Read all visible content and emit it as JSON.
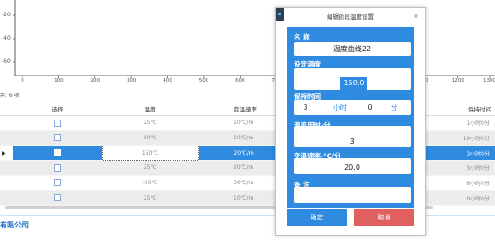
{
  "colors": {
    "accent": "#2e8be0",
    "cancel": "#e05f5f",
    "row_alt": "#ececec"
  },
  "chart": {
    "y_labels": [
      "-20",
      "-40",
      "-60"
    ],
    "x_labels": [
      "0",
      "100",
      "200",
      "300",
      "400",
      "500",
      "600",
      "700",
      "800",
      "900",
      "1000",
      "1100",
      "1200",
      "1300"
    ]
  },
  "table": {
    "summary": "共: 6 项",
    "columns": {
      "select": "选择",
      "temperature": "温度",
      "rate": "变温速率",
      "hold": "保持时间"
    },
    "rows": [
      {
        "temperature": "25℃",
        "rate": "10℃/m",
        "hold": "1小时0分",
        "selected": false
      },
      {
        "temperature": "80℃",
        "rate": "10℃/m",
        "hold": "10小时0分",
        "selected": false
      },
      {
        "temperature": "150℃",
        "rate": "20℃/m",
        "hold": "3小时0分",
        "selected": true
      },
      {
        "temperature": "25℃",
        "rate": "20℃/m",
        "hold": "3小时0分",
        "selected": false
      },
      {
        "temperature": "-50℃",
        "rate": "30℃/m",
        "hold": "6小时0分",
        "selected": false
      },
      {
        "temperature": "25℃",
        "rate": "10℃/m",
        "hold": "0小时0分",
        "selected": false
      }
    ]
  },
  "footer": {
    "company": "有限公司"
  },
  "dialog": {
    "title": "编辑阶段温度设置",
    "close": "x",
    "name_label": "名 称",
    "name_value": "温度曲线22",
    "temp_label": "设定温度",
    "temp_value": "150.0",
    "hold_label": "保持时间",
    "hold_hours": "3",
    "hours_unit": "小时",
    "hold_minutes": "0",
    "minutes_unit": "分",
    "ramp_time_label": "温变用时-分",
    "ramp_time_value": "3",
    "rate_label": "变温速率-℃/分",
    "rate_value": "20.0",
    "remark_label": "备 注",
    "remark_value": "",
    "ok_label": "确定",
    "cancel_label": "取消"
  }
}
